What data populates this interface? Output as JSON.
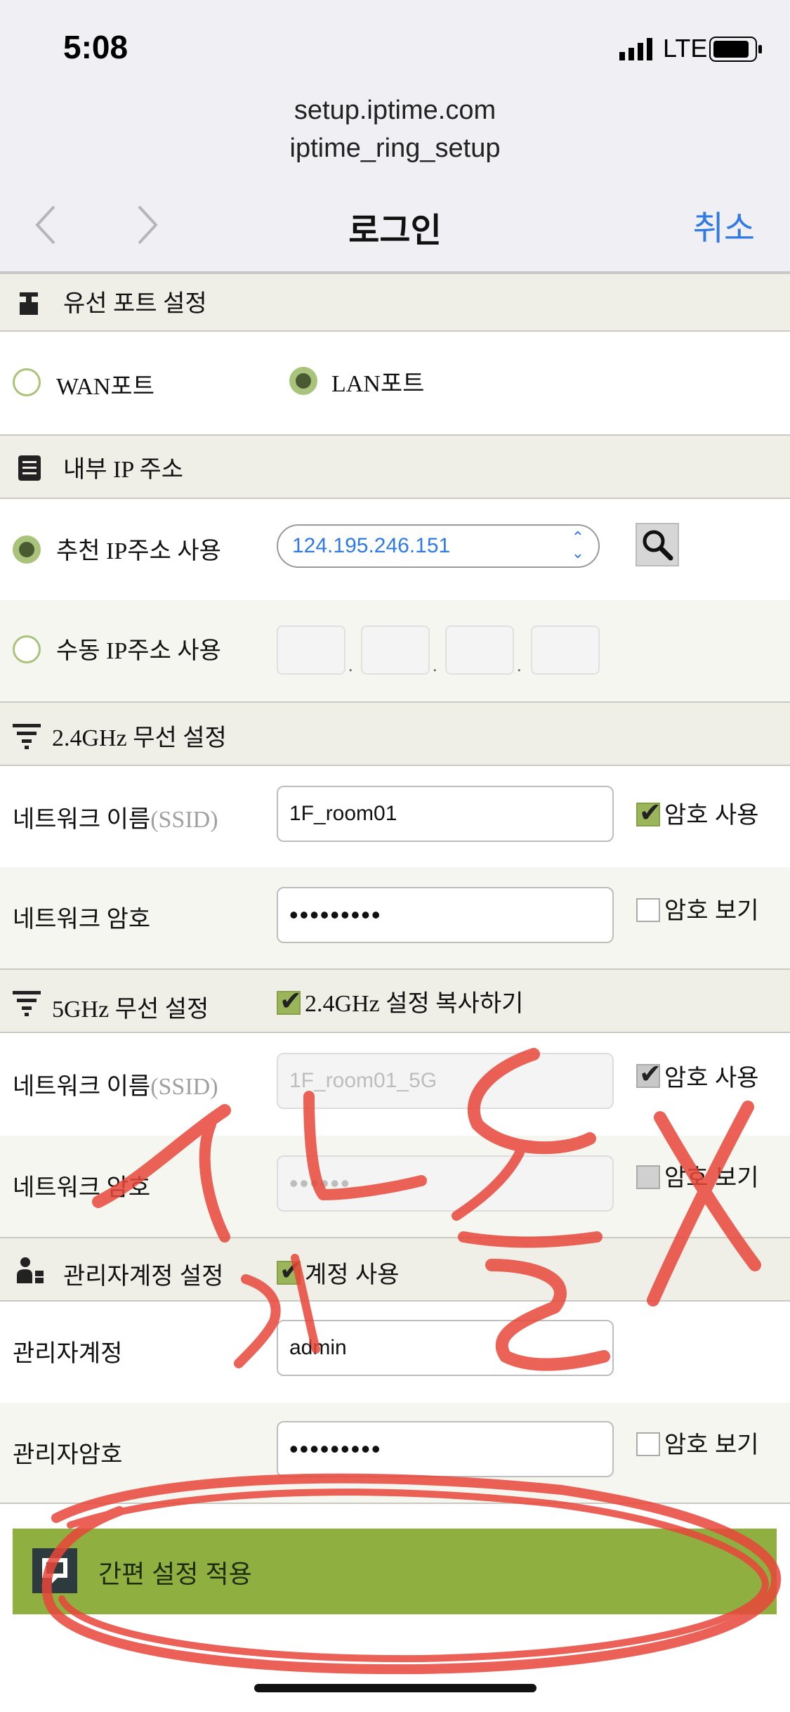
{
  "status": {
    "time": "5:08",
    "carrier": "LTE"
  },
  "browser": {
    "url_line1": "setup.iptime.com",
    "url_line2": "iptime_ring_setup",
    "title": "로그인",
    "cancel": "취소"
  },
  "wired_port": {
    "header": "유선 포트 설정",
    "wan_label": "WAN포트",
    "lan_label": "LAN포트",
    "selected": "LAN"
  },
  "internal_ip": {
    "header": "내부 IP 주소",
    "recommended_label": "추천 IP주소 사용",
    "recommended_value": "124.195.246.151",
    "manual_label": "수동 IP주소 사용"
  },
  "wifi24": {
    "header": "2.4GHz 무선 설정",
    "ssid_label_main": "네트워크 이름",
    "ssid_label_dim": "(SSID)",
    "ssid_value": "1F_room01",
    "use_password_label": "암호 사용",
    "password_label": "네트워크 암호",
    "password_value": "•••••••••",
    "show_password_label": "암호 보기"
  },
  "wifi5": {
    "header": "5GHz 무선 설정",
    "copy_label": "2.4GHz 설정 복사하기",
    "ssid_label_main": "네트워크 이름",
    "ssid_label_dim": "(SSID)",
    "ssid_value": "1F_room01_5G",
    "use_password_label": "암호 사용",
    "password_label": "네트워크 암호",
    "password_value": "••••••",
    "show_password_label": "암호 보기"
  },
  "admin": {
    "header": "관리자계정 설정",
    "use_account_label": "계정 사용",
    "account_label": "관리자계정",
    "account_value": "admin",
    "password_label": "관리자암호",
    "password_value": "•••••••••",
    "show_password_label": "암호 보기"
  },
  "apply_button": "간편 설정 적용",
  "colors": {
    "accent_green": "#8fb040",
    "link_blue": "#2f7ae5",
    "scribble_red": "#e8463a"
  }
}
